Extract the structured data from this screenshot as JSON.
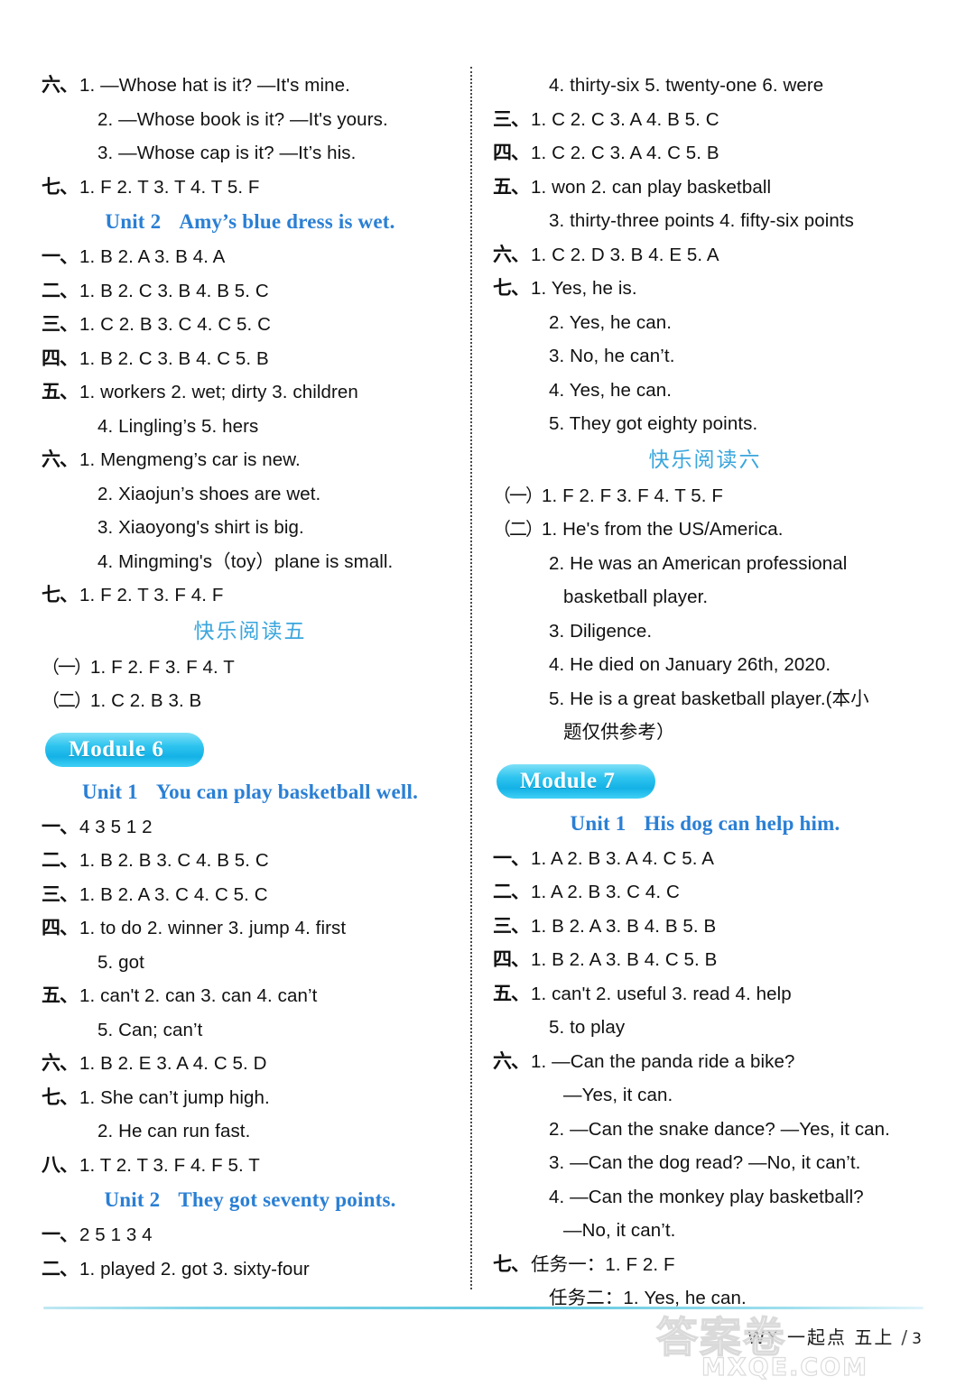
{
  "page": {
    "footer_label": "WY 一起点 五上",
    "page_separator": "/",
    "page_number": "3",
    "watermark_cn": "答案卷",
    "watermark_en": "MXQE.COM"
  },
  "left_column": [
    {
      "kind": "answer",
      "marker": "六、",
      "text": "1. —Whose hat is it? —It's mine."
    },
    {
      "kind": "answer",
      "marker": "",
      "indent": 1,
      "text": "2. —Whose book is it? —It's yours."
    },
    {
      "kind": "answer",
      "marker": "",
      "indent": 1,
      "text": "3. —Whose cap is it? —It’s his."
    },
    {
      "kind": "answer",
      "marker": "七、",
      "text": "1. F    2. T    3. T    4. T    5. F"
    },
    {
      "kind": "unit",
      "unit_no": "Unit 2",
      "unit_title": "Amy’s blue dress is wet."
    },
    {
      "kind": "answer",
      "marker": "一、",
      "text": "1. B    2. A    3. B    4. A"
    },
    {
      "kind": "answer",
      "marker": "二、",
      "text": "1. B    2. C    3. B    4. B    5. C"
    },
    {
      "kind": "answer",
      "marker": "三、",
      "text": "1. C    2. B    3. C    4. C    5. C"
    },
    {
      "kind": "answer",
      "marker": "四、",
      "text": "1. B    2. C    3. B    4. C    5. B"
    },
    {
      "kind": "answer",
      "marker": "五、",
      "text": "1. workers    2. wet; dirty    3. children"
    },
    {
      "kind": "answer",
      "marker": "",
      "indent": 1,
      "text": "4. Lingling’s    5. hers"
    },
    {
      "kind": "answer",
      "marker": "六、",
      "text": "1. Mengmeng’s car is new."
    },
    {
      "kind": "answer",
      "marker": "",
      "indent": 1,
      "text": "2. Xiaojun’s shoes are wet."
    },
    {
      "kind": "answer",
      "marker": "",
      "indent": 1,
      "text": "3. Xiaoyong's shirt is big."
    },
    {
      "kind": "answer",
      "marker": "",
      "indent": 1,
      "text": "4. Mingming's（toy）plane is small."
    },
    {
      "kind": "answer",
      "marker": "七、",
      "text": "1. F    2. T    3. F    4. F"
    },
    {
      "kind": "reading",
      "title": "快乐阅读五"
    },
    {
      "kind": "answer",
      "marker": "（一）",
      "paren": true,
      "text": "1. F    2. F    3. F    4. T"
    },
    {
      "kind": "answer",
      "marker": "（二）",
      "paren": true,
      "text": "1. C    2. B    3. B"
    },
    {
      "kind": "module",
      "label": "Module 6"
    },
    {
      "kind": "unit",
      "unit_no": "Unit 1",
      "unit_title": "You can play basketball well."
    },
    {
      "kind": "answer",
      "marker": "一、",
      "text": "4   3   5   1   2"
    },
    {
      "kind": "answer",
      "marker": "二、",
      "text": "1. B    2. B    3. C    4. B    5. C"
    },
    {
      "kind": "answer",
      "marker": "三、",
      "text": "1. B    2. A    3. C    4. C    5. C"
    },
    {
      "kind": "answer",
      "marker": "四、",
      "text": "1. to do    2. winner    3. jump    4. first"
    },
    {
      "kind": "answer",
      "marker": "",
      "indent": 1,
      "text": "5. got"
    },
    {
      "kind": "answer",
      "marker": "五、",
      "text": "1. can't    2. can    3. can    4. can’t"
    },
    {
      "kind": "answer",
      "marker": "",
      "indent": 1,
      "text": "5. Can; can’t"
    },
    {
      "kind": "answer",
      "marker": "六、",
      "text": "1. B    2. E    3. A    4. C    5. D"
    },
    {
      "kind": "answer",
      "marker": "七、",
      "text": "1. She can’t jump high."
    },
    {
      "kind": "answer",
      "marker": "",
      "indent": 1,
      "text": "2. He can run fast."
    },
    {
      "kind": "answer",
      "marker": "八、",
      "text": "1. T    2. T    3. F    4. F    5. T"
    },
    {
      "kind": "unit",
      "unit_no": "Unit 2",
      "unit_title": "They got seventy points."
    },
    {
      "kind": "answer",
      "marker": "一、",
      "text": "2   5   1   3   4"
    },
    {
      "kind": "answer",
      "marker": "二、",
      "text": "1. played    2. got    3. sixty-four"
    }
  ],
  "right_column": [
    {
      "kind": "answer",
      "marker": "",
      "indent": 1,
      "text": "4. thirty-six    5. twenty-one    6. were"
    },
    {
      "kind": "answer",
      "marker": "三、",
      "text": "1. C    2. C    3. A    4. B    5. C"
    },
    {
      "kind": "answer",
      "marker": "四、",
      "text": "1. C    2. C    3. A    4. C    5. B"
    },
    {
      "kind": "answer",
      "marker": "五、",
      "text": "1. won    2. can play basketball"
    },
    {
      "kind": "answer",
      "marker": "",
      "indent": 1,
      "text": "3. thirty-three points    4. fifty-six points"
    },
    {
      "kind": "answer",
      "marker": "六、",
      "text": "1. C    2. D    3. B    4. E    5. A"
    },
    {
      "kind": "answer",
      "marker": "七、",
      "text": "1. Yes, he is."
    },
    {
      "kind": "answer",
      "marker": "",
      "indent": 1,
      "text": "2. Yes, he can."
    },
    {
      "kind": "answer",
      "marker": "",
      "indent": 1,
      "text": "3. No, he can’t."
    },
    {
      "kind": "answer",
      "marker": "",
      "indent": 1,
      "text": "4. Yes, he can."
    },
    {
      "kind": "answer",
      "marker": "",
      "indent": 1,
      "text": "5. They got eighty points."
    },
    {
      "kind": "reading",
      "title": "快乐阅读六"
    },
    {
      "kind": "answer",
      "marker": "（一）",
      "paren": true,
      "text": "1. F    2. F    3. F    4. T    5. F"
    },
    {
      "kind": "answer",
      "marker": "（二）",
      "paren": true,
      "text": "1. He's from the US/America."
    },
    {
      "kind": "answer",
      "marker": "",
      "indent": 1,
      "text": "2. He was an American professional"
    },
    {
      "kind": "answer",
      "marker": "",
      "indent": 2,
      "text": "basketball player."
    },
    {
      "kind": "answer",
      "marker": "",
      "indent": 1,
      "text": "3. Diligence."
    },
    {
      "kind": "answer",
      "marker": "",
      "indent": 1,
      "text": "4. He died on January 26th, 2020."
    },
    {
      "kind": "answer",
      "marker": "",
      "indent": 1,
      "text": "5. He is a great basketball player.(本小"
    },
    {
      "kind": "answer",
      "marker": "",
      "indent": 2,
      "text": "题仅供参考）"
    },
    {
      "kind": "module",
      "label": "Module 7"
    },
    {
      "kind": "unit",
      "unit_no": "Unit 1",
      "unit_title": "His dog can help him."
    },
    {
      "kind": "answer",
      "marker": "一、",
      "text": "1. A    2. B    3. A    4. C    5. A"
    },
    {
      "kind": "answer",
      "marker": "二、",
      "text": "1. A    2. B    3. C    4. C"
    },
    {
      "kind": "answer",
      "marker": "三、",
      "text": "1. B    2. A    3. B    4. B    5. B"
    },
    {
      "kind": "answer",
      "marker": "四、",
      "text": "1. B    2. A    3. B    4. C    5. B"
    },
    {
      "kind": "answer",
      "marker": "五、",
      "text": "1. can't    2. useful    3. read    4. help"
    },
    {
      "kind": "answer",
      "marker": "",
      "indent": 1,
      "text": "5. to play"
    },
    {
      "kind": "answer",
      "marker": "六、",
      "text": "1. —Can the panda ride a bike?"
    },
    {
      "kind": "answer",
      "marker": "",
      "indent": 2,
      "text": "—Yes, it can."
    },
    {
      "kind": "answer",
      "marker": "",
      "indent": 1,
      "text": "2. —Can the snake dance? —Yes, it can."
    },
    {
      "kind": "answer",
      "marker": "",
      "indent": 1,
      "text": "3. —Can the dog read? —No, it can’t."
    },
    {
      "kind": "answer",
      "marker": "",
      "indent": 1,
      "text": "4. —Can the monkey play basketball?"
    },
    {
      "kind": "answer",
      "marker": "",
      "indent": 2,
      "text": "—No, it can’t."
    },
    {
      "kind": "answer",
      "marker": "七、",
      "text": "任务一：1. F    2. F"
    },
    {
      "kind": "answer",
      "marker": "",
      "indent": 1,
      "text": "任务二：1. Yes, he can."
    }
  ],
  "colors": {
    "unit_heading": "#2a7fd4",
    "reading_heading": "#3aa6dd",
    "module_badge": "#14b2e6",
    "footer_rule": "#5fc8e0",
    "text": "#111111"
  }
}
